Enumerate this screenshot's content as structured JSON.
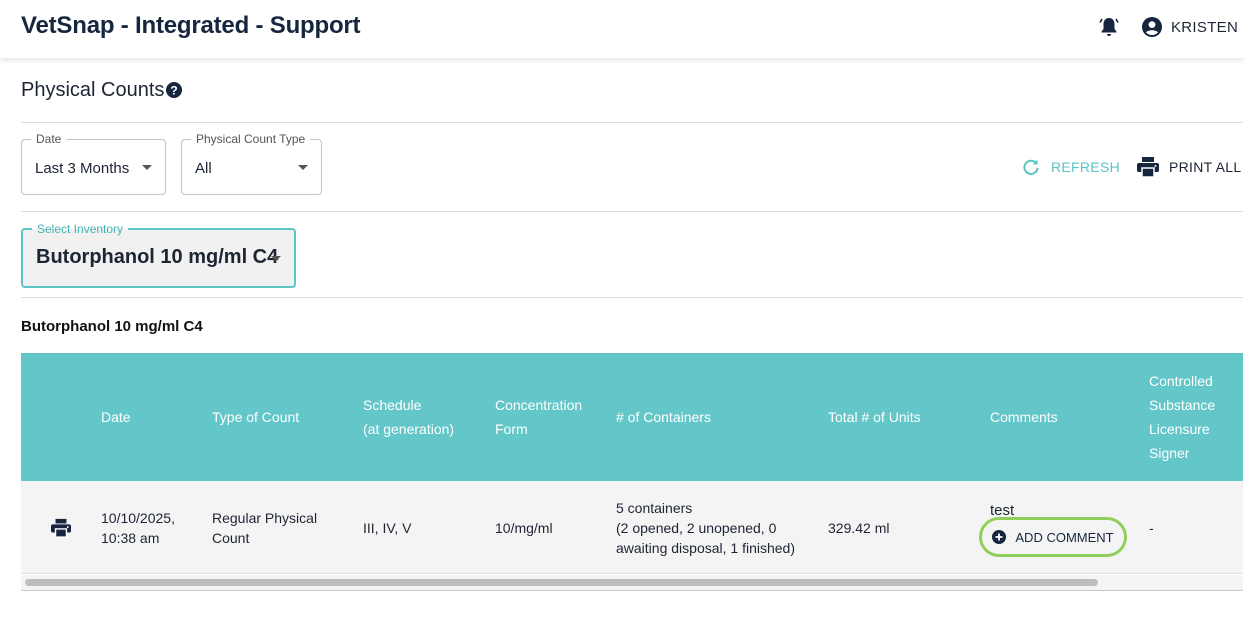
{
  "app": {
    "title": "VetSnap - Integrated - Support",
    "user_name": "KRISTEN"
  },
  "page": {
    "title": "Physical Counts"
  },
  "filters": {
    "date": {
      "label": "Date",
      "value": "Last 3 Months"
    },
    "type": {
      "label": "Physical Count Type",
      "value": "All"
    },
    "inventory": {
      "label": "Select Inventory",
      "value": "Butorphanol 10 mg/ml C4"
    }
  },
  "actions": {
    "refresh_label": "REFRESH",
    "print_all_label": "PRINT ALL"
  },
  "section_title": "Butorphanol 10 mg/ml C4",
  "table": {
    "headers": {
      "date": "Date",
      "type": "Type of Count",
      "schedule_1": "Schedule",
      "schedule_2": "(at generation)",
      "concentration_1": "Concentration",
      "concentration_2": "Form",
      "containers": "# of Containers",
      "units": "Total # of Units",
      "comments": "Comments",
      "signer_1": "Controlled",
      "signer_2": "Substance",
      "signer_3": "Licensure",
      "signer_4": "Signer"
    },
    "rows": [
      {
        "date_1": "10/10/2025,",
        "date_2": "10:38 am",
        "type_1": "Regular Physical",
        "type_2": "Count",
        "schedule": "III, IV, V",
        "concentration": "10/mg/ml",
        "containers_1": "5 containers",
        "containers_2": "(2 opened, 2 unopened, 0",
        "containers_3": "awaiting disposal, 1 finished)",
        "units": "329.42 ml",
        "comment": "test",
        "add_comment_label": "ADD COMMENT",
        "signer": "-"
      }
    ]
  },
  "colors": {
    "header_bg": "#63c6c9",
    "accent": "#5cc3c3",
    "highlight": "#8fcf5a",
    "title_text": "#16263f"
  },
  "icons": [
    "bell-icon",
    "account-icon",
    "help-icon",
    "refresh-icon",
    "printer-icon",
    "plus-circle-icon"
  ]
}
